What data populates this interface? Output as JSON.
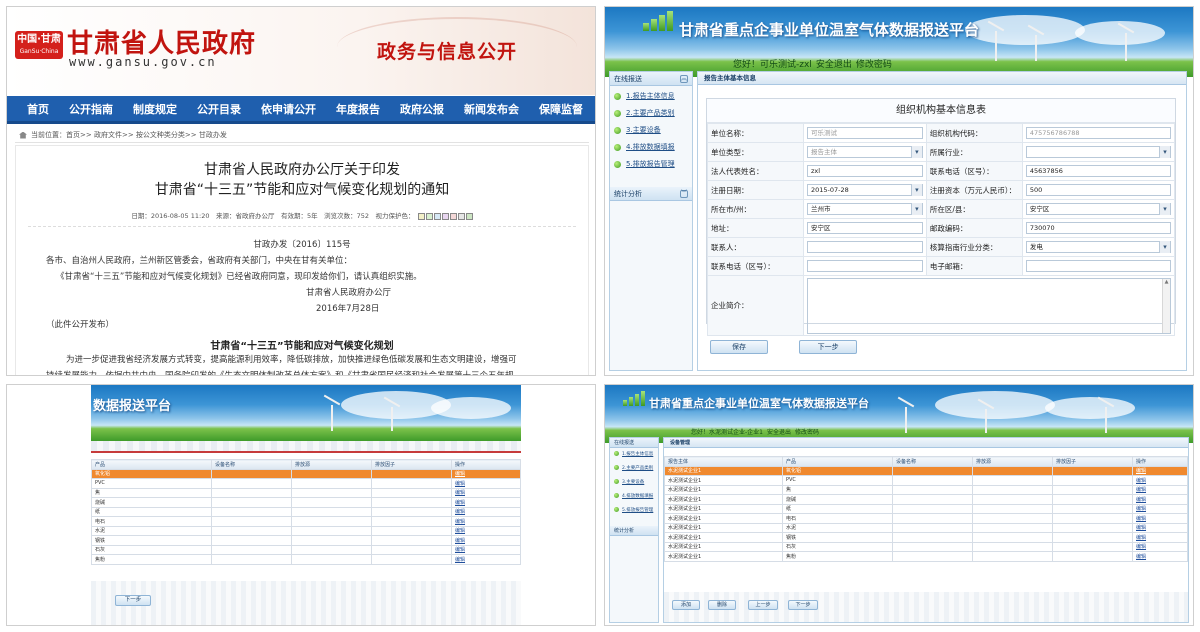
{
  "gansu": {
    "logo_text": "中国·甘肃",
    "logo_sub": "GanSu·China",
    "site_title": "甘肃省人民政府",
    "site_url": "www.gansu.gov.cn",
    "slogan": "政务与信息公开",
    "nav": [
      "首页",
      "公开指南",
      "制度规定",
      "公开目录",
      "依申请公开",
      "年度报告",
      "政府公报",
      "新闻发布会",
      "保障监督"
    ],
    "breadcrumb": "当前位置：首页>> 政府文件>> 按公文种类分类>> 甘政办发",
    "title_line1": "甘肃省人民政府办公厅关于印发",
    "title_line2": "甘肃省“十三五”节能和应对气候变化规划的通知",
    "meta": "日期：2016-08-05 11:20　来源：省政府办公厅　有效期：5年　浏览次数：752　视力保护色：",
    "protect_colors": [
      "#f3f0c8",
      "#d8f0d0",
      "#d6e8f5",
      "#e9d6f0",
      "#f4d8d8",
      "#e6e6e6",
      "#cde6c4"
    ],
    "doc_no": "甘政办发〔2016〕115号",
    "recipients": "各市、自治州人民政府，兰州新区管委会，省政府有关部门，中央在甘有关单位：",
    "body1": "《甘肃省“十三五”节能和应对气候变化规划》已经省政府同意，现印发给你们，请认真组织实施。",
    "signer": "甘肃省人民政府办公厅",
    "date": "2016年7月28日",
    "publish_note": "（此件公开发布）",
    "plan_title": "甘肃省“十三五”节能和应对气候变化规划",
    "para1": "为进一步促进我省经济发展方式转变，提高能源利用效率，降低碳排放，加快推进绿色低碳发展和生态文明建设，增强可",
    "para2": "持续发展能力，依据中共中央、国务院印发的《生态文明体制改革总体方案》和《甘肃省国民经济和社会发展第十三个五年规"
  },
  "platform": {
    "title": "甘肃省重点企事业单位温室气体数据报送平台",
    "title_partial": "数据报送平台",
    "greeting": "您好！可乐测试-zxl",
    "logout": "安全退出",
    "change_pwd": "修改密码",
    "greeting_p4": "您好！水泥测试企业-企业1",
    "sidebar_head": "在线报送",
    "sidebar_items": [
      "1.报告主体信息",
      "2.主要产品类别",
      "3.主要设备",
      "4.排放数据填报",
      "5.排放报告管理"
    ],
    "sidebar_stats": "统计分析"
  },
  "form": {
    "tab": "报告主体基本信息",
    "caption": "组织机构基本信息表",
    "rows": [
      {
        "l1": "单位名称：",
        "v1": "可乐测试",
        "l2": "组织机构代码：",
        "v2": "475756786788"
      },
      {
        "l1": "单位类型：",
        "v1": "报告主体",
        "l2": "所属行业：",
        "v2": ""
      },
      {
        "l1": "法人代表姓名：",
        "v1": "zxl",
        "l2": "联系电话（区号）：",
        "v2": "45637856"
      },
      {
        "l1": "注册日期：",
        "v1": "2015-07-28",
        "l2": "注册资本（万元人民币）：",
        "v2": "500"
      },
      {
        "l1": "所在市/州：",
        "v1": "兰州市",
        "l2": "所在区/县：",
        "v2": "安宁区"
      },
      {
        "l1": "地址：",
        "v1": "安宁区",
        "l2": "邮政编码：",
        "v2": "730070"
      },
      {
        "l1": "联系人：",
        "v1": "",
        "l2": "核算指南行业分类：",
        "v2": "发电"
      },
      {
        "l1": "联系电话（区号）：",
        "v1": "",
        "l2": "电子邮箱：",
        "v2": ""
      }
    ],
    "intro_label": "企业简介：",
    "save": "保存",
    "next": "下一步"
  },
  "products": {
    "headers": [
      "产品",
      "设备名称",
      "排放源",
      "排放因子",
      "操作"
    ],
    "rows": [
      "氧化铝",
      "PVC",
      "焦",
      "烧碱",
      "纸",
      "电石",
      "水泥",
      "钢铁",
      "石灰",
      "焦粉"
    ],
    "op": "编辑",
    "next": "下一步"
  },
  "equipment": {
    "tab": "设备管理",
    "headers": [
      "报告主体",
      "产品",
      "设备名称",
      "排放源",
      "排放因子",
      "操作"
    ],
    "entity": "水泥测试企业1",
    "rows": [
      "氧化铝",
      "PVC",
      "焦",
      "烧碱",
      "纸",
      "电石",
      "水泥",
      "钢铁",
      "石灰",
      "焦粉"
    ],
    "op": "编辑",
    "buttons": [
      "添加",
      "删除",
      "上一步",
      "下一步"
    ]
  }
}
